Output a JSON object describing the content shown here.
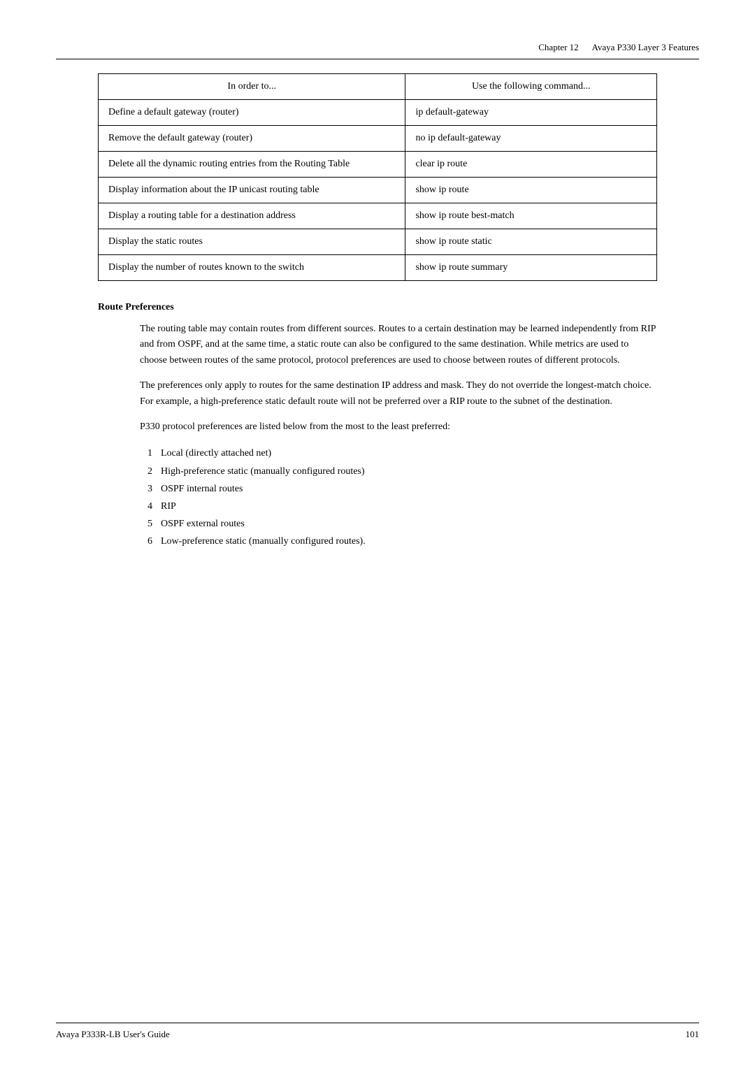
{
  "header": {
    "chapter": "Chapter 12",
    "title": "Avaya P330 Layer 3 Features"
  },
  "table": {
    "col1_header": "In order to...",
    "col2_header": "Use the following command...",
    "rows": [
      {
        "action": "Define a default gateway (router)",
        "command": "ip default-gateway"
      },
      {
        "action": "Remove the default gateway (router)",
        "command": "no ip default-gateway"
      },
      {
        "action": "Delete all the dynamic routing entries from the Routing Table",
        "command": "clear ip route"
      },
      {
        "action": "Display information about the IP unicast routing table",
        "command": "show ip route"
      },
      {
        "action": "Display a routing table for a destination address",
        "command": "show ip route best-match"
      },
      {
        "action": "Display the static routes",
        "command": "show ip route static"
      },
      {
        "action": "Display the number of routes known to the switch",
        "command": "show ip route summary"
      }
    ]
  },
  "route_preferences": {
    "section_title": "Route Preferences",
    "paragraph1": "The routing table may contain routes from different sources. Routes to a certain destination may be learned independently from RIP and from OSPF, and at the same time, a static route can also be configured to the same destination. While metrics are used to choose between routes of the same protocol, protocol preferences are used to choose between routes of different protocols.",
    "paragraph2": "The preferences only apply to routes for the same destination IP address and mask. They do not override the longest-match choice. For example, a high-preference static default route will not be preferred over a RIP route to the subnet of the destination.",
    "paragraph3": "P330 protocol preferences are listed below from the most to the least preferred:",
    "list": [
      {
        "num": "1",
        "text": "Local (directly attached net)"
      },
      {
        "num": "2",
        "text": "High-preference static (manually configured routes)"
      },
      {
        "num": "3",
        "text": "OSPF internal routes"
      },
      {
        "num": "4",
        "text": "RIP"
      },
      {
        "num": "5",
        "text": "OSPF external routes"
      },
      {
        "num": "6",
        "text": "Low-preference static (manually configured routes)."
      }
    ]
  },
  "footer": {
    "left": "Avaya P333R-LB User's Guide",
    "right": "101"
  }
}
